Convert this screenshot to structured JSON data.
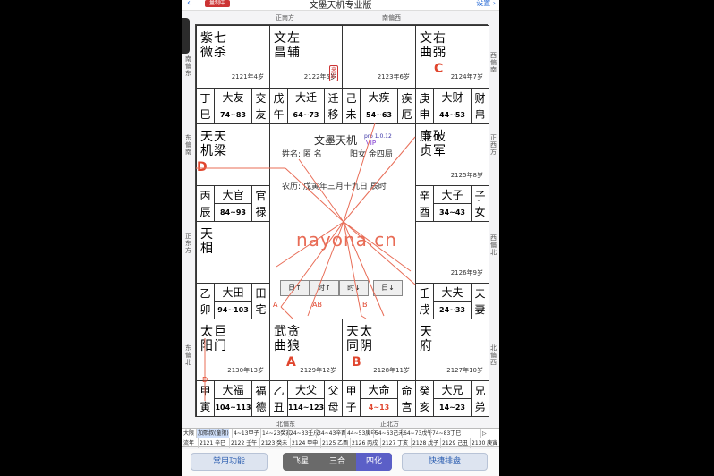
{
  "status": {
    "back": "‹",
    "pill": "量制中",
    "title": "文墨天机专业版",
    "settings": "设置 ›"
  },
  "directions": {
    "top_left": "正南方",
    "top_right": "南偏西",
    "right_top": "西偏南",
    "right_mid": "正西方",
    "right_low": "西偏北",
    "right_bottom": "北偏西",
    "bottom_left": "北偏东",
    "bottom_right": "正北方",
    "left_top": "南偏东",
    "left_mid": "东偏南",
    "left_low": "正东方",
    "left_bottom": "东偏北"
  },
  "palaces": [
    {
      "stars": [
        "紫七",
        "微杀"
      ],
      "year": "2121年4岁",
      "ganzhi": [
        "丁",
        "巳"
      ],
      "palace": "大友",
      "range": "74~83",
      "gong": [
        "交",
        "友"
      ]
    },
    {
      "stars": [
        "文左",
        "昌辅"
      ],
      "year": "2122年5岁",
      "badge": "来因",
      "ganzhi": [
        "戊",
        "午"
      ],
      "palace": "大迁",
      "range": "64~73",
      "gong": [
        "迁",
        "移"
      ]
    },
    {
      "stars": [],
      "year": "2123年6岁",
      "ganzhi": [
        "己",
        "未"
      ],
      "palace": "大疾",
      "range": "54~63",
      "gong": [
        "疾",
        "厄"
      ]
    },
    {
      "stars": [
        "文右",
        "曲弼"
      ],
      "year": "2124年7岁",
      "hua": "C",
      "ganzhi": [
        "庚",
        "申"
      ],
      "palace": "大财",
      "range": "44~53",
      "gong": [
        "财",
        "帛"
      ]
    },
    {
      "stars": [
        "天天",
        "机梁"
      ],
      "year": "",
      "hua": "D",
      "ganzhi": [
        "丙",
        "辰"
      ],
      "palace": "大官",
      "range": "84~93",
      "gong": [
        "官",
        "禄"
      ]
    },
    {
      "stars": [
        "廉破",
        "贞军"
      ],
      "year": "2125年8岁",
      "ganzhi": [
        "辛",
        "酉"
      ],
      "palace": "大子",
      "range": "34~43",
      "gong": [
        "子",
        "女"
      ]
    },
    {
      "stars": [
        "天",
        "相"
      ],
      "year": "",
      "ganzhi": [
        "乙",
        "卯"
      ],
      "palace": "大田",
      "range": "94~103",
      "gong": [
        "田",
        "宅"
      ]
    },
    {
      "stars": [],
      "year": "2126年9岁",
      "ganzhi": [
        "壬",
        "戌"
      ],
      "palace": "大夫",
      "range": "24~33",
      "gong": [
        "夫",
        "妻"
      ]
    },
    {
      "stars": [
        "太巨",
        "阳门"
      ],
      "year": "2130年13岁",
      "ganzhi": [
        "甲",
        "寅"
      ],
      "palace": "大福",
      "range": "104~113",
      "gong": [
        "福",
        "德"
      ]
    },
    {
      "stars": [
        "武贪",
        "曲狼"
      ],
      "year": "2129年12岁",
      "hua": "A",
      "ganzhi": [
        "乙",
        "丑"
      ],
      "palace": "大父",
      "range": "114~123",
      "gong": [
        "父",
        "母"
      ]
    },
    {
      "stars": [
        "天太",
        "同阴"
      ],
      "year": "2128年11岁",
      "hua": "B",
      "ganzhi": [
        "甲",
        "子"
      ],
      "palace": "大命",
      "range": "4~13",
      "range_red": true,
      "gong": [
        "命",
        "宫"
      ]
    },
    {
      "stars": [
        "天",
        "府"
      ],
      "year": "2127年10岁",
      "ganzhi": [
        "癸",
        "亥"
      ],
      "palace": "大兄",
      "range": "14~23",
      "gong": [
        "兄",
        "弟"
      ]
    }
  ],
  "center": {
    "title": "文墨天机",
    "version": "pro 1.0.12",
    "vip": "VIP",
    "name": "姓名: 匿 名",
    "gender": "阳女 金四局",
    "lunar": "农历: 戊寅年三月十九日 辰时",
    "watermark": "nayona.cn",
    "buttons": [
      "日↑",
      "时↑",
      "时↓",
      "日↓"
    ],
    "arrow_labels": [
      "A",
      "AB",
      "B",
      "D"
    ]
  },
  "dayun": {
    "row1_label": "大限",
    "row1": [
      "加熙叔(童限)",
      "4~13甲子",
      "14~23癸亥",
      "24~33壬戌",
      "34~43辛酉",
      "44~53庚申",
      "54~63己未",
      "64~73戊午",
      "74~83丁巳",
      "▷"
    ],
    "row2_label": "流年",
    "row2": [
      "2121 辛巳",
      "2122 壬午",
      "2123 癸未",
      "2124 甲申",
      "2125 乙酉",
      "2126 丙戌",
      "2127 丁亥",
      "2128 戊子",
      "2129 己丑",
      "2130 庚寅"
    ]
  },
  "tabbar": {
    "left": "常用功能",
    "tabs": [
      "飞星",
      "三合",
      "四化"
    ],
    "active": 2,
    "right": "快捷排盘"
  }
}
